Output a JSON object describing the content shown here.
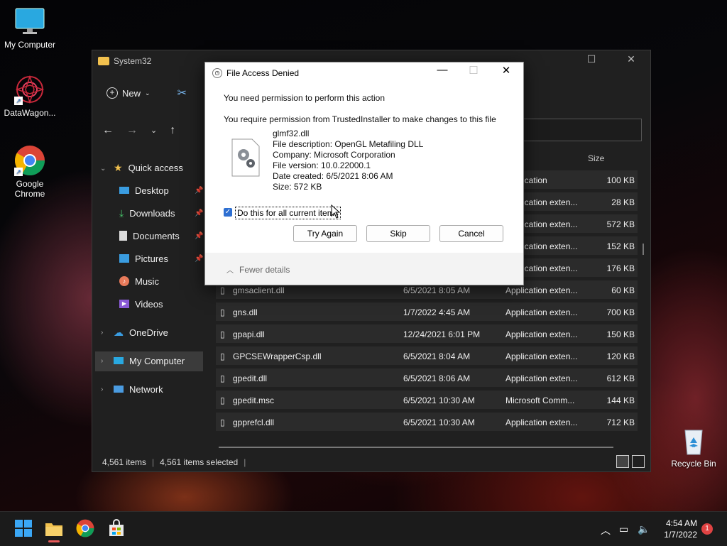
{
  "desktop": {
    "icons": [
      {
        "label": "My Computer"
      },
      {
        "label": "DataWagon..."
      },
      {
        "label": "Google Chrome"
      },
      {
        "label": "Recycle Bin"
      }
    ]
  },
  "explorer": {
    "title": "System32",
    "toolbar": {
      "new_label": "New"
    },
    "column_size": "Size",
    "nav": [
      {
        "label": "Quick access"
      },
      {
        "label": "Desktop"
      },
      {
        "label": "Downloads"
      },
      {
        "label": "Documents"
      },
      {
        "label": "Pictures"
      },
      {
        "label": "Music"
      },
      {
        "label": "Videos"
      },
      {
        "label": "OneDrive"
      },
      {
        "label": "My Computer"
      },
      {
        "label": "Network"
      }
    ],
    "hidden_rows": [
      {
        "type": "Application",
        "size": "100 KB"
      },
      {
        "type": "Application exten...",
        "size": "28 KB"
      },
      {
        "type": "Application exten...",
        "size": "572 KB"
      },
      {
        "type": "Application exten...",
        "size": "152 KB"
      },
      {
        "type": "Application exten...",
        "size": "176 KB"
      }
    ],
    "rows": [
      {
        "name": "gmsaclient.dll",
        "date": "6/5/2021 8:05 AM",
        "type": "Application exten...",
        "size": "60 KB"
      },
      {
        "name": "gns.dll",
        "date": "1/7/2022 4:45 AM",
        "type": "Application exten...",
        "size": "700 KB"
      },
      {
        "name": "gpapi.dll",
        "date": "12/24/2021 6:01 PM",
        "type": "Application exten...",
        "size": "150 KB"
      },
      {
        "name": "GPCSEWrapperCsp.dll",
        "date": "6/5/2021 8:04 AM",
        "type": "Application exten...",
        "size": "120 KB"
      },
      {
        "name": "gpedit.dll",
        "date": "6/5/2021 8:06 AM",
        "type": "Application exten...",
        "size": "612 KB"
      },
      {
        "name": "gpedit.msc",
        "date": "6/5/2021 10:30 AM",
        "type": "Microsoft Comm...",
        "size": "144 KB"
      },
      {
        "name": "gpprefcl.dll",
        "date": "6/5/2021 10:30 AM",
        "type": "Application exten...",
        "size": "712 KB"
      }
    ],
    "status": {
      "items": "4,561 items",
      "selected": "4,561 items selected",
      "sep": "|"
    }
  },
  "dialog": {
    "title": "File Access Denied",
    "line1": "You need permission to perform this action",
    "line2": "You require permission from TrustedInstaller to make changes to this file",
    "file": {
      "name": "glmf32.dll",
      "description": "File description: OpenGL Metafiling DLL",
      "company": "Company: Microsoft Corporation",
      "version": "File version: 10.0.22000.1",
      "created": "Date created: 6/5/2021 8:06 AM",
      "size": "Size: 572 KB"
    },
    "checkbox_label": "Do this for all current items",
    "buttons": {
      "try_again": "Try Again",
      "skip": "Skip",
      "cancel": "Cancel"
    },
    "fewer_details": "Fewer details"
  },
  "taskbar": {
    "time": "4:54 AM",
    "date": "1/7/2022",
    "notifications": "1"
  },
  "colors": {
    "accent": "#2e6fd1",
    "notif": "#e04343"
  }
}
